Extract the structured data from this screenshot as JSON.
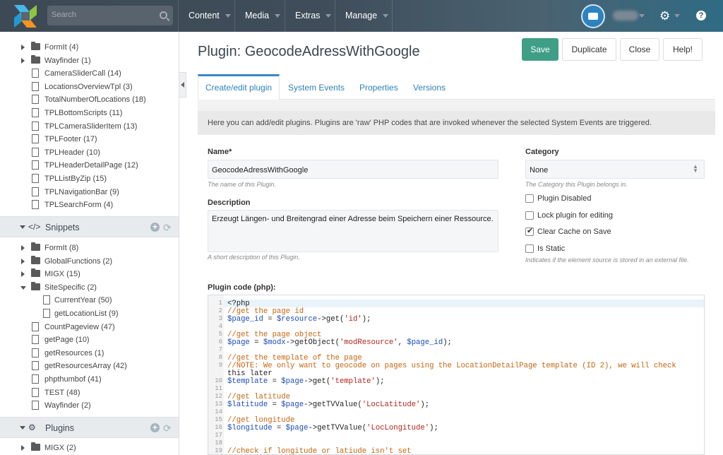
{
  "topbar": {
    "search_placeholder": "Search",
    "nav": [
      "Content",
      "Media",
      "Extras",
      "Manage"
    ],
    "help": "?",
    "icons": {
      "logo": "modx-logo",
      "search": "search-icon",
      "user": "avatar-icon",
      "settings": "gear-icon",
      "help": "help-icon"
    }
  },
  "sidebar": {
    "items_top": [
      {
        "label": "FormIt (4)",
        "type": "folder"
      },
      {
        "label": "Wayfinder (1)",
        "type": "folder"
      },
      {
        "label": "CameraSliderCall (14)",
        "type": "doc"
      },
      {
        "label": "LocationsOverviewTpl (3)",
        "type": "doc"
      },
      {
        "label": "TotalNumberOfLocations (18)",
        "type": "doc"
      },
      {
        "label": "TPLBottomScripts (11)",
        "type": "doc"
      },
      {
        "label": "TPLCameraSliderItem (13)",
        "type": "doc"
      },
      {
        "label": "TPLFooter (17)",
        "type": "doc"
      },
      {
        "label": "TPLHeader (10)",
        "type": "doc"
      },
      {
        "label": "TPLHeaderDetailPage (12)",
        "type": "doc"
      },
      {
        "label": "TPLListByZip (15)",
        "type": "doc"
      },
      {
        "label": "TPLNavigationBar (9)",
        "type": "doc"
      },
      {
        "label": "TPLSearchForm (4)",
        "type": "doc"
      }
    ],
    "snippets_title": "Snippets",
    "snippets": [
      {
        "label": "FormIt (8)",
        "type": "folder"
      },
      {
        "label": "GlobalFunctions (2)",
        "type": "folder"
      },
      {
        "label": "MIGX (15)",
        "type": "folder"
      },
      {
        "label": "SiteSpecific (2)",
        "type": "folder-open"
      },
      {
        "label": "CurrentYear (50)",
        "type": "doc-nested"
      },
      {
        "label": "getLocationList (9)",
        "type": "doc-nested"
      },
      {
        "label": "CountPageview (47)",
        "type": "doc"
      },
      {
        "label": "getPage (10)",
        "type": "doc"
      },
      {
        "label": "getResources (1)",
        "type": "doc"
      },
      {
        "label": "getResourcesArray (42)",
        "type": "doc"
      },
      {
        "label": "phpthumbof (41)",
        "type": "doc"
      },
      {
        "label": "TEST (48)",
        "type": "doc"
      },
      {
        "label": "Wayfinder (2)",
        "type": "doc"
      }
    ],
    "plugins_title": "Plugins",
    "plugins": [
      {
        "label": "MIGX (2)",
        "type": "folder"
      }
    ]
  },
  "main": {
    "title": "Plugin: GeocodeAdressWithGoogle",
    "buttons": {
      "save": "Save",
      "duplicate": "Duplicate",
      "close": "Close",
      "help": "Help!"
    },
    "tabs": [
      "Create/edit plugin",
      "System Events",
      "Properties",
      "Versions"
    ],
    "description_bar": "Here you can add/edit plugins. Plugins are 'raw' PHP codes that are invoked whenever the selected System Events are triggered.",
    "name_label": "Name*",
    "name_value": "GeocodeAdressWithGoogle",
    "name_hint": "The name of this Plugin.",
    "desc_label": "Description",
    "desc_value": "Erzeugt Längen- und Breitengrad einer Adresse beim Speichern einer Ressource.",
    "desc_hint": "A short description of this Plugin.",
    "category_label": "Category",
    "category_value": "None",
    "category_hint": "The Category this Plugin belongs in.",
    "checkboxes": [
      {
        "label": "Plugin Disabled",
        "checked": false
      },
      {
        "label": "Lock plugin for editing",
        "checked": false
      },
      {
        "label": "Clear Cache on Save",
        "checked": true
      },
      {
        "label": "Is Static",
        "checked": false
      }
    ],
    "static_hint": "Indicates if the element source is stored in an external file.",
    "code_label": "Plugin code (php):",
    "code_lines": [
      {
        "n": "1",
        "t": "<?php"
      },
      {
        "n": "2",
        "t": "//get the page id"
      },
      {
        "n": "3",
        "t": "$page_id = $resource->get('id');"
      },
      {
        "n": "4",
        "t": ""
      },
      {
        "n": "5",
        "t": "//get the page object"
      },
      {
        "n": "6",
        "t": "$page = $modx->getObject('modResource', $page_id);"
      },
      {
        "n": "7",
        "t": ""
      },
      {
        "n": "8",
        "t": "//get the template of the page"
      },
      {
        "n": "9",
        "t": "//NOTE: We only want to geocode on pages using the LocationDetailPage template (ID 2), we will check"
      },
      {
        "n": "",
        "t": "this later"
      },
      {
        "n": "10",
        "t": "$template = $page->get('template');"
      },
      {
        "n": "11",
        "t": ""
      },
      {
        "n": "12",
        "t": "//get latitude"
      },
      {
        "n": "13",
        "t": "$latitude = $page->getTVValue('LocLatitude');"
      },
      {
        "n": "14",
        "t": ""
      },
      {
        "n": "15",
        "t": "//get longitude"
      },
      {
        "n": "16",
        "t": "$longitude = $page->getTVValue('LocLongitude');"
      },
      {
        "n": "17",
        "t": ""
      },
      {
        "n": "18",
        "t": ""
      },
      {
        "n": "19",
        "t": "//check if longitude or latiude isn't set"
      }
    ]
  }
}
